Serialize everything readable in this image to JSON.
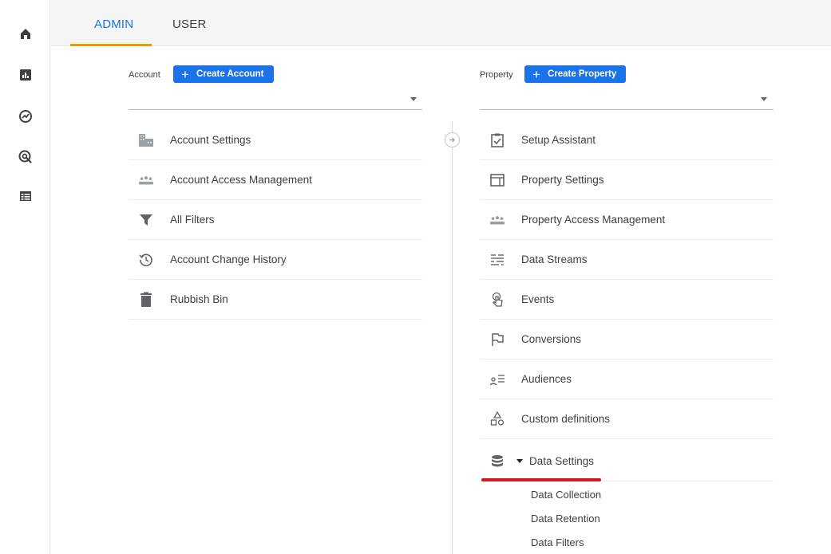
{
  "nav_rail": {
    "items": [
      {
        "icon": "home-icon"
      },
      {
        "icon": "reports-icon"
      },
      {
        "icon": "explore-icon"
      },
      {
        "icon": "advertising-icon"
      },
      {
        "icon": "configure-icon"
      }
    ]
  },
  "tabs": [
    {
      "label": "ADMIN",
      "active": true
    },
    {
      "label": "USER",
      "active": false
    }
  ],
  "account_column": {
    "label": "Account",
    "create_label": "Create Account",
    "selected_value": "",
    "items": [
      {
        "label": "Account Settings",
        "icon": "building-icon"
      },
      {
        "label": "Account Access Management",
        "icon": "people-icon"
      },
      {
        "label": "All Filters",
        "icon": "filter-icon"
      },
      {
        "label": "Account Change History",
        "icon": "history-icon"
      },
      {
        "label": "Rubbish Bin",
        "icon": "trash-icon"
      }
    ]
  },
  "property_column": {
    "label": "Property",
    "create_label": "Create Property",
    "selected_value": "",
    "items": [
      {
        "label": "Setup Assistant",
        "icon": "clipboard-check-icon"
      },
      {
        "label": "Property Settings",
        "icon": "window-icon"
      },
      {
        "label": "Property Access Management",
        "icon": "people-icon"
      },
      {
        "label": "Data Streams",
        "icon": "streams-icon"
      },
      {
        "label": "Events",
        "icon": "touch-icon"
      },
      {
        "label": "Conversions",
        "icon": "flag-icon"
      },
      {
        "label": "Audiences",
        "icon": "audience-icon"
      },
      {
        "label": "Custom definitions",
        "icon": "shapes-icon"
      },
      {
        "label": "Data Settings",
        "icon": "database-icon"
      }
    ],
    "data_settings_children": [
      "Data Collection",
      "Data Retention",
      "Data Filters"
    ]
  },
  "colors": {
    "accent": "#1a73e8",
    "tab_underline": "#f29900",
    "highlight": "#d8161b",
    "icon": "#5f6368"
  }
}
